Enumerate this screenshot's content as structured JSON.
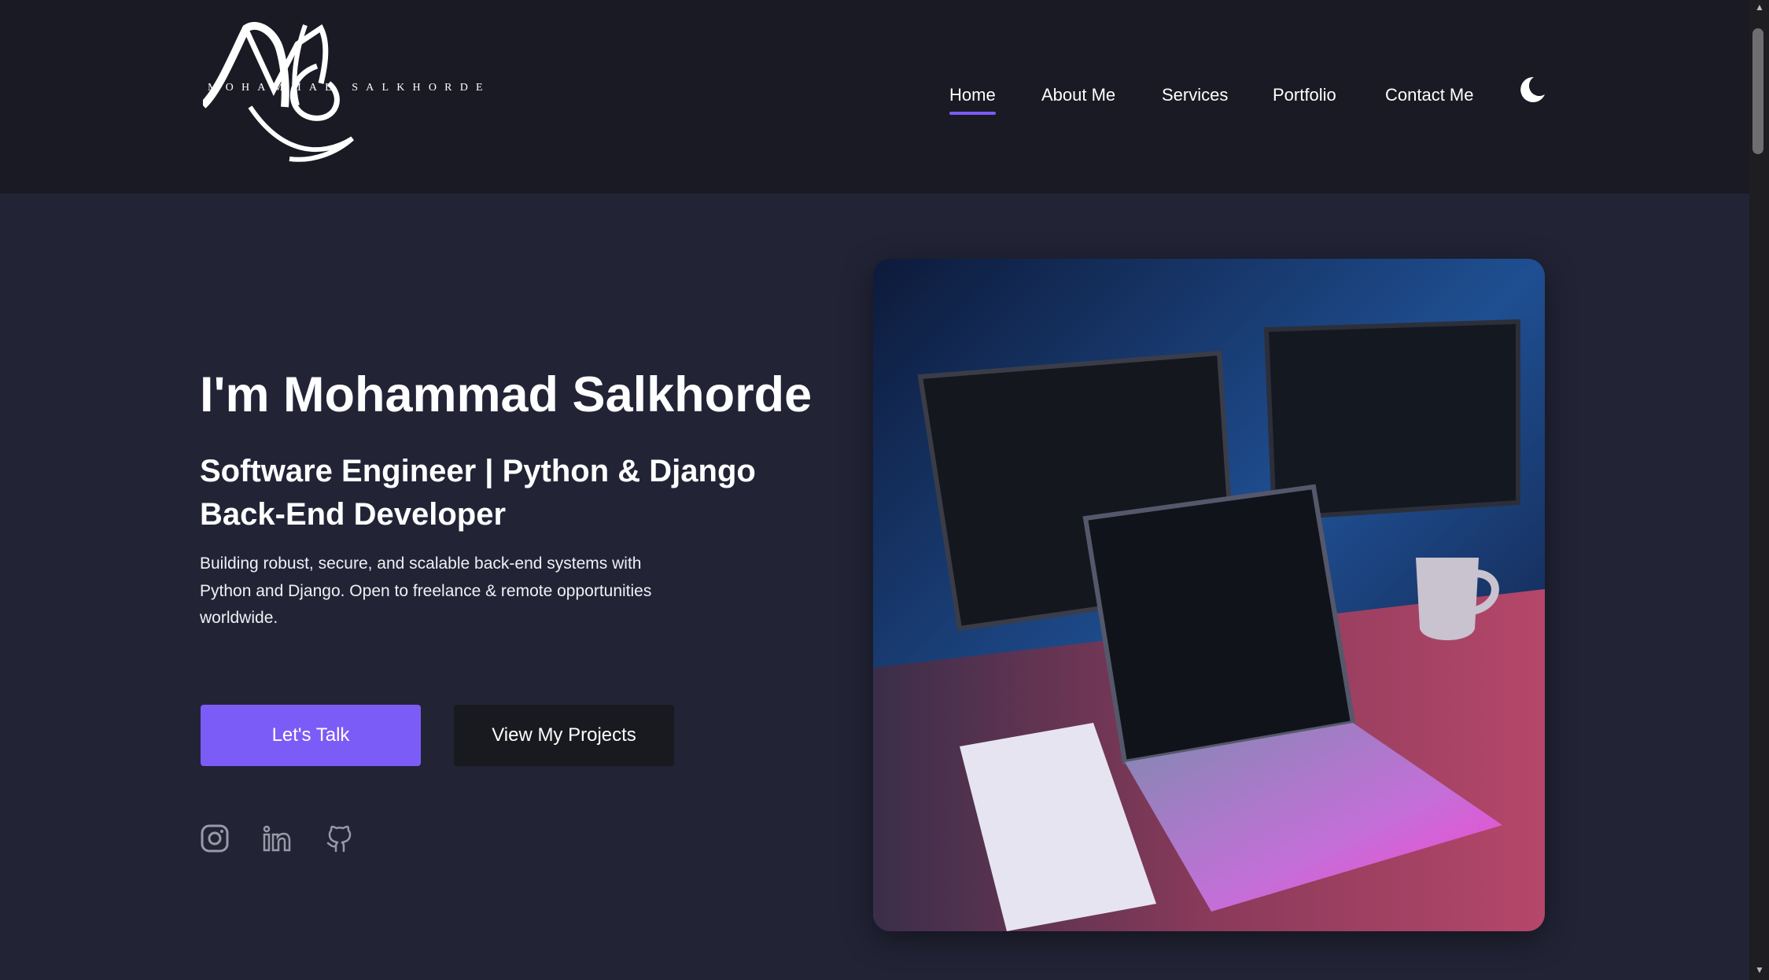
{
  "brand": {
    "logo_monogram": "MS",
    "logo_text": "MOHAMMAD SALKHORDE"
  },
  "nav": {
    "items": [
      {
        "label": "Home",
        "active": true
      },
      {
        "label": "About Me",
        "active": false
      },
      {
        "label": "Services",
        "active": false
      },
      {
        "label": "Portfolio",
        "active": false
      },
      {
        "label": "Contact Me",
        "active": false
      }
    ],
    "theme_toggle_icon": "moon-icon"
  },
  "hero": {
    "title": "I'm Mohammad Salkhorde",
    "subtitle": "Software Engineer | Python & Django Back-End Developer",
    "description": "Building robust, secure, and scalable back-end systems with Python and Django. Open to freelance & remote opportunities worldwide.",
    "primary_button": "Let's Talk",
    "secondary_button": "View My Projects",
    "image_icon": "workspace-photo"
  },
  "social": {
    "icons": [
      "instagram-icon",
      "linkedin-icon",
      "github-icon"
    ]
  },
  "colors": {
    "header_bg": "#191a23",
    "page_bg": "#222436",
    "accent": "#7b5cf6",
    "secondary_button_bg": "#191a1f"
  }
}
